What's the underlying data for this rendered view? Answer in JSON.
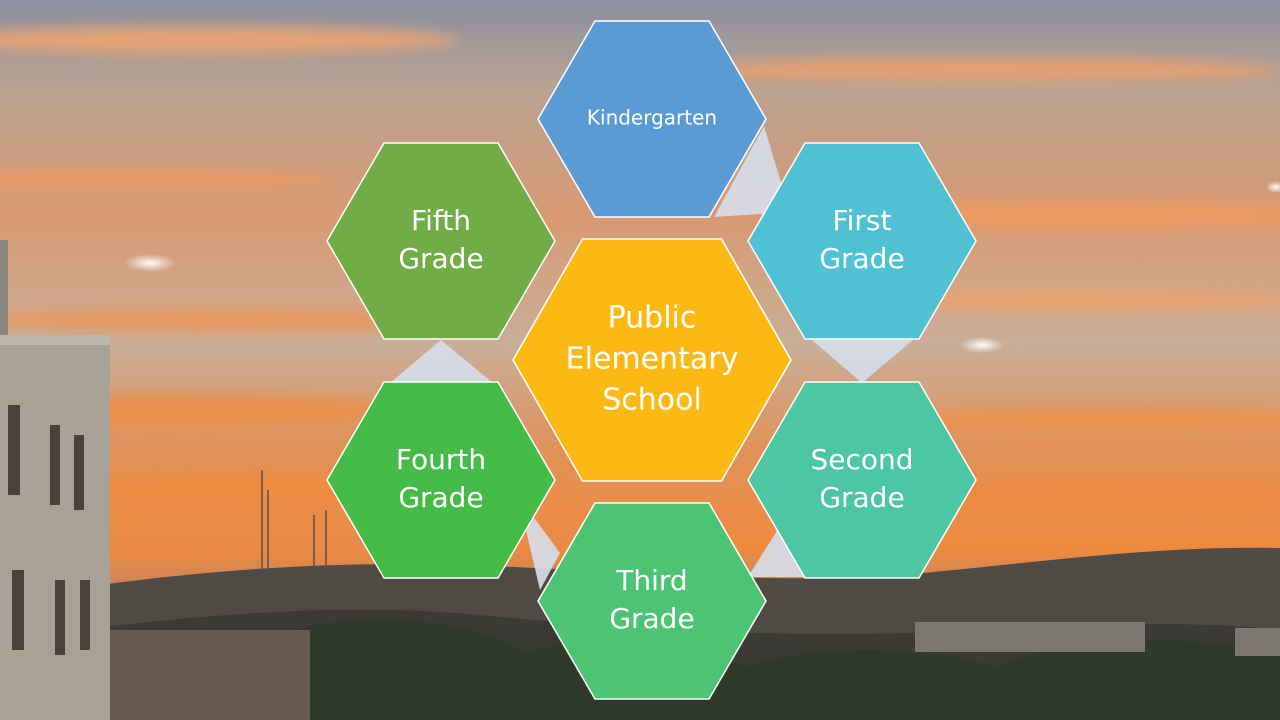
{
  "slide": {
    "center": {
      "lines": [
        "Public",
        "Elementary",
        "School"
      ],
      "color": "#FDB913"
    },
    "grades": [
      {
        "lines": [
          "Kindergarten"
        ],
        "color": "#5B9BD5"
      },
      {
        "lines": [
          "First",
          "Grade"
        ],
        "color": "#4FC1D3"
      },
      {
        "lines": [
          "Second",
          "Grade"
        ],
        "color": "#4DC6A2"
      },
      {
        "lines": [
          "Third",
          "Grade"
        ],
        "color": "#4CC473"
      },
      {
        "lines": [
          "Fourth",
          "Grade"
        ],
        "color": "#45BC48"
      },
      {
        "lines": [
          "Fifth",
          "Grade"
        ],
        "color": "#70AD47"
      }
    ],
    "connector_color": "#D6DCE8",
    "background": "sunset-sky-photo"
  }
}
